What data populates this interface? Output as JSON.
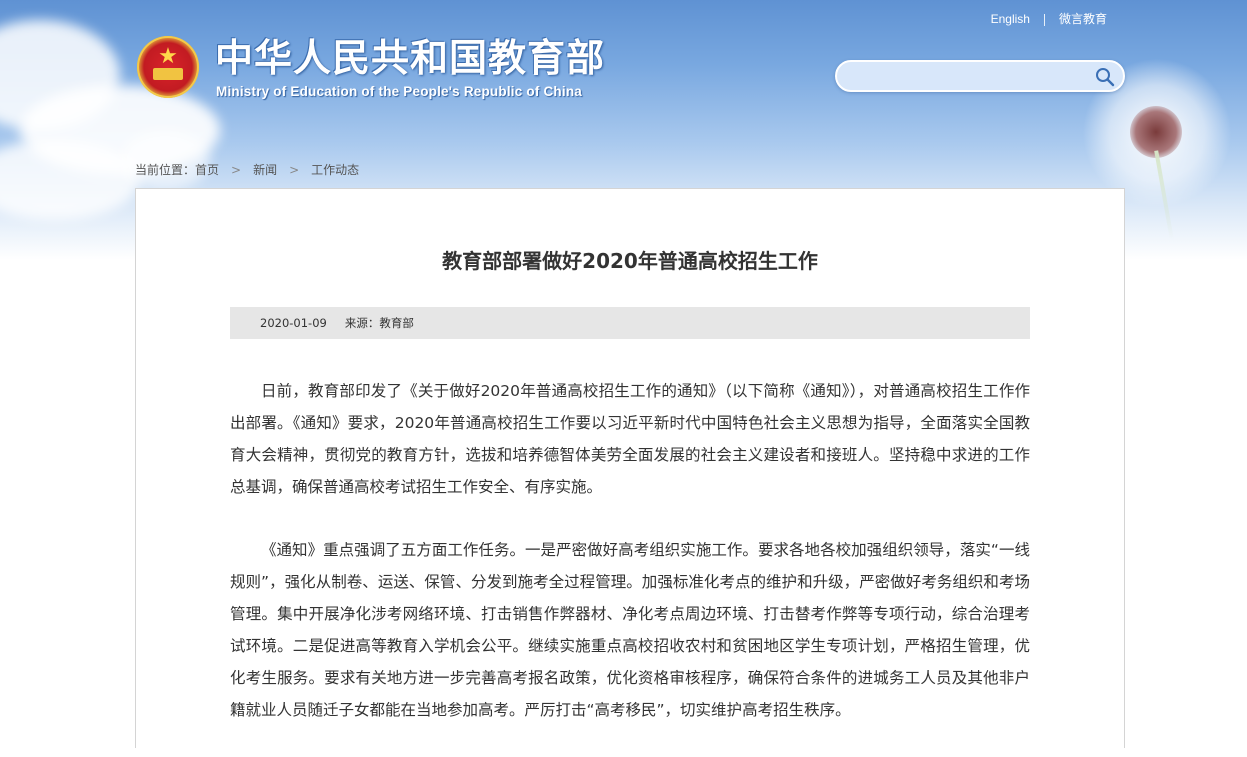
{
  "header": {
    "site_title": "中华人民共和国教育部",
    "site_subtitle": "Ministry of Education of the People's Republic of China",
    "top_links": [
      "English",
      "微言教育"
    ],
    "search": {
      "value": "",
      "placeholder": ""
    }
  },
  "breadcrumb": {
    "label": "当前位置：",
    "items": [
      "首页",
      "新闻",
      "工作动态"
    ]
  },
  "article": {
    "title": "教育部部署做好2020年普通高校招生工作",
    "date": "2020-01-09",
    "source": "来源：教育部",
    "paragraphs": [
      "日前，教育部印发了《关于做好2020年普通高校招生工作的通知》（以下简称《通知》），对普通高校招生工作作出部署。《通知》要求，2020年普通高校招生工作要以习近平新时代中国特色社会主义思想为指导，全面落实全国教育大会精神，贯彻党的教育方针，选拔和培养德智体美劳全面发展的社会主义建设者和接班人。坚持稳中求进的工作总基调，确保普通高校考试招生工作安全、有序实施。",
      "《通知》重点强调了五方面工作任务。一是严密做好高考组织实施工作。要求各地各校加强组织领导，落实“一线规则”，强化从制卷、运送、保管、分发到施考全过程管理。加强标准化考点的维护和升级，严密做好考务组织和考场管理。集中开展净化涉考网络环境、打击销售作弊器材、净化考点周边环境、打击替考作弊等专项行动，综合治理考试环境。二是促进高等教育入学机会公平。继续实施重点高校招收农村和贫困地区学生专项计划，严格招生管理，优化考生服务。要求有关地方进一步完善高考报名政策，优化资格审核程序，确保符合条件的进城务工人员及其他非户籍就业人员随迁子女都能在当地参加高考。严厉打击“高考移民”，切实维护高考招生秩序。"
    ]
  },
  "colors": {
    "banner_top": "#5f92d3",
    "text_main": "#333333",
    "meta_bar_bg": "#e6e6e6",
    "box_border": "#d4d4d4"
  },
  "icons": {
    "search": "magnifier-icon",
    "breadcrumb_separator": "chevron-right-icon",
    "emblem": "national-emblem-icon"
  }
}
